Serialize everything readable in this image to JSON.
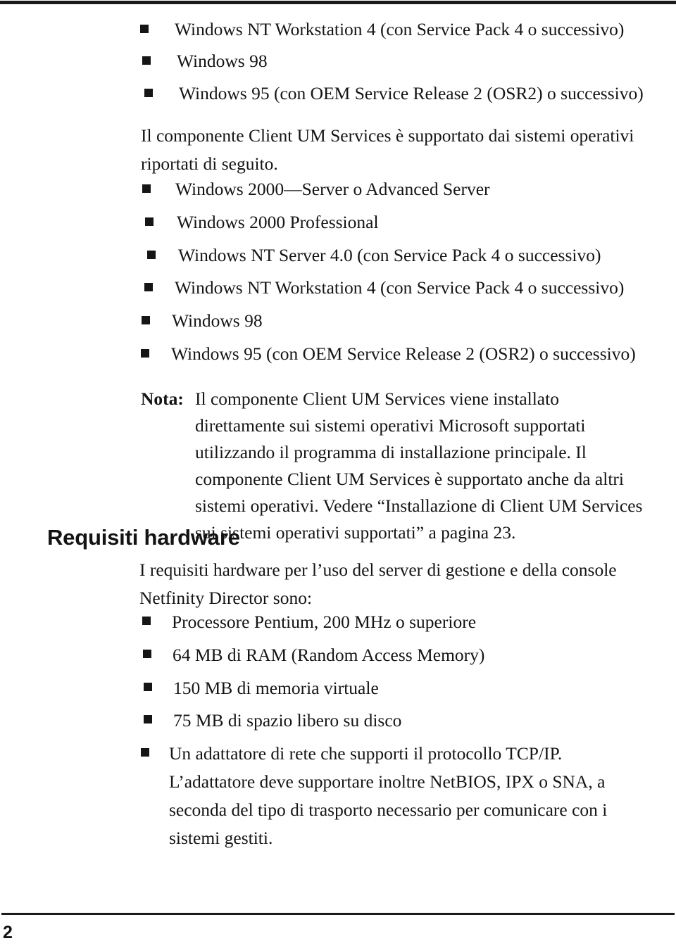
{
  "page": {
    "folio": "2",
    "language": "it",
    "bullet_glyph": "square-bullet"
  },
  "os_list_top": {
    "items": [
      "Windows NT Workstation 4 (con Service Pack 4 o successivo)",
      "Windows 98",
      "Windows 95 (con OEM Service Release 2 (OSR2) o successivo)"
    ]
  },
  "client_intro": {
    "text": "Il componente Client UM Services è supportato dai sistemi operativi\nriportati di seguito."
  },
  "client_os_list": {
    "items": [
      "Windows 2000—Server o Advanced Server",
      "Windows 2000 Professional",
      "Windows NT Server 4.0 (con Service Pack 4 o successivo)",
      "Windows NT Workstation 4 (con Service Pack 4 o successivo)",
      "Windows 98",
      "Windows 95 (con OEM Service Release 2 (OSR2) o successivo)"
    ]
  },
  "note": {
    "label": "Nota:",
    "body": "Il componente Client UM Services viene installato\ndirettamente sui sistemi operativi Microsoft supportati\nutilizzando il programma di installazione principale. Il\ncomponente Client UM Services è supportato anche da altri\nsistemi operativi. Vedere “Installazione di Client UM Services\nsui sistemi operativi supportati” a pagina 23."
  },
  "hardware_section": {
    "heading": "Requisiti hardware",
    "intro": "I requisiti hardware per l’uso del server di gestione e della console\nNetfinity Director sono:",
    "items": [
      "Processore Pentium, 200 MHz o superiore",
      "64 MB di RAM (Random Access Memory)",
      "150 MB di memoria virtuale",
      "75 MB di spazio libero su disco",
      "Un adattatore di rete che supporti il protocollo TCP/IP.\nL’adattatore deve supportare inoltre NetBIOS, IPX o SNA, a\nseconda del tipo di trasporto necessario per comunicare con i\nsistemi gestiti."
    ]
  }
}
